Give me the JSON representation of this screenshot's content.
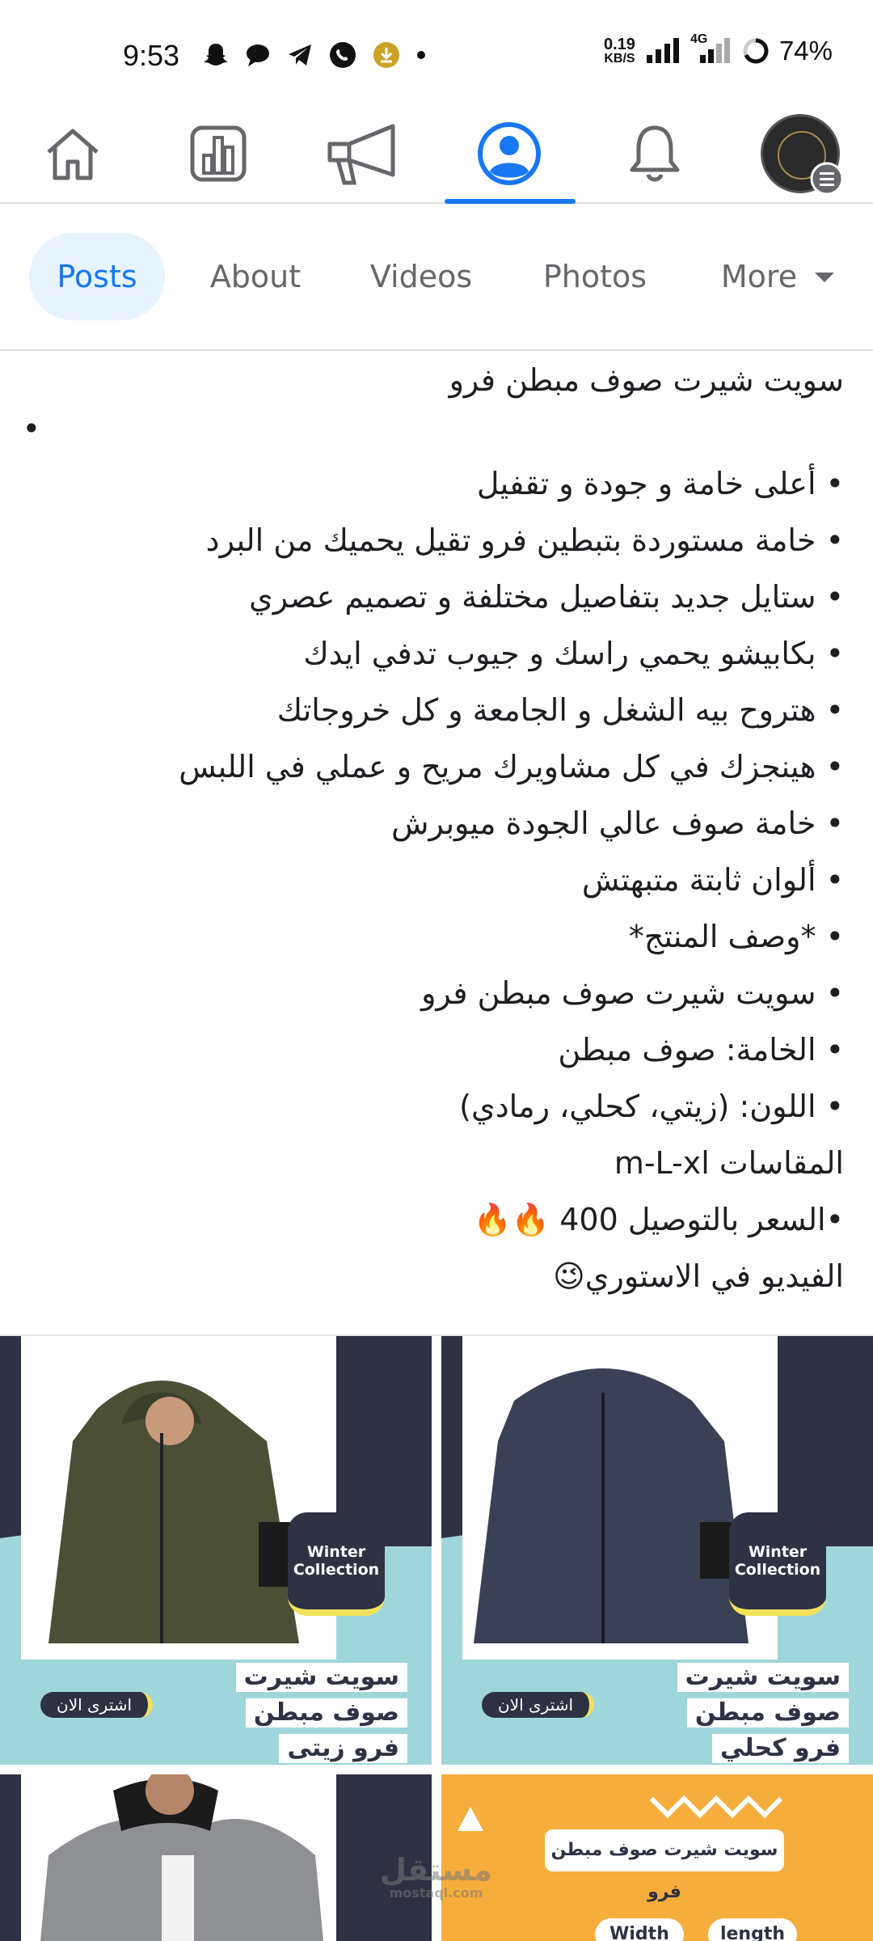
{
  "status": {
    "time": "9:53",
    "speed_top": "0.19",
    "speed_bottom": "KB/S",
    "network": "4G",
    "battery": "74%"
  },
  "nav": {
    "items": [
      {
        "name": "home-icon"
      },
      {
        "name": "dashboard-icon"
      },
      {
        "name": "megaphone-icon"
      },
      {
        "name": "profile-icon",
        "active": true
      },
      {
        "name": "bell-icon"
      },
      {
        "name": "page-avatar-menu-icon"
      }
    ],
    "accent": "#1877f2"
  },
  "tabs": [
    "Posts",
    "About",
    "Videos",
    "Photos",
    "More"
  ],
  "post": {
    "lines": [
      "سويت شيرت صوف مبطن فرو",
      "•",
      "• أعلى خامة و جودة و تقفيل",
      "• خامة مستوردة بتبطين فرو تقيل يحميك من البرد",
      "• ستايل جديد بتفاصيل مختلفة و تصميم عصري",
      "• بكابيشو يحمي راسك و جيوب تدفي ايدك",
      "• هتروح بيه الشغل و الجامعة و كل خروجاتك",
      "• هينجزك في كل مشاويرك مريح و عملي في اللبس",
      "• خامة صوف عالي الجودة ميوبرش",
      "• ألوان ثابتة متبهتش",
      "• *وصف المنتج*",
      "• سويت شيرت صوف مبطن فرو",
      "• الخامة: صوف مبطن",
      "• اللون: (زيتي، كحلي، رمادي)",
      "المقاسات m-L-xl",
      "•السعر بالتوصيل 400 🔥🔥",
      "الفيديو في الاستوري😉"
    ]
  },
  "photos": [
    {
      "badge": "Winter Collection",
      "title": [
        "سويت شيرت",
        "صوف مبطن",
        "فرو زيتى"
      ],
      "cta": "اشترى الان",
      "jacket_color": "#4a4f36"
    },
    {
      "badge": "Winter Collection",
      "title": [
        "سويت شيرت",
        "صوف مبطن",
        "فرو كحلي"
      ],
      "cta": "اشترى الان",
      "jacket_color": "#3a4154"
    },
    {
      "jacket_color": "#8f9094"
    },
    {
      "banner": "سويت شيرت صوف مبطن فرو",
      "chips": [
        "Width",
        "length"
      ],
      "watermark": "مستقل",
      "watermark_sub": "mostaql.com"
    }
  ]
}
